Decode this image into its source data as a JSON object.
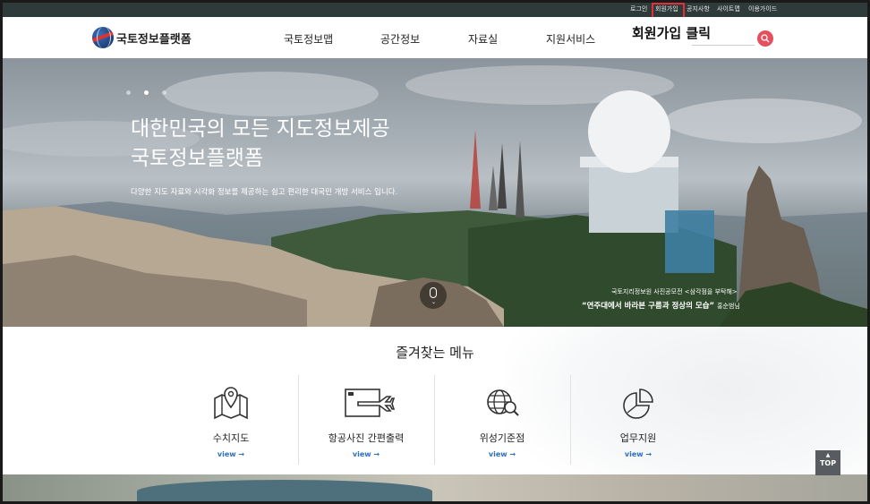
{
  "topbar": {
    "links": [
      "로그인",
      "회원가입",
      "공지사항",
      "사이트맵",
      "이용가이드"
    ]
  },
  "header": {
    "brand": "국토정보플랫폼",
    "nav": [
      "국토정보맵",
      "공간정보",
      "자료실",
      "지원서비스"
    ],
    "callout": "회원가입 클릭"
  },
  "hero": {
    "title_line1": "대한민국의 모든 지도정보제공",
    "title_line2": "국토정보플랫폼",
    "subtitle": "다양한 지도 자료와 시각화 정보를 제공하는 쉽고 편리한 대국민 개방 서비스 입니다.",
    "photo_caption": "국토지리정보원 사진공모전 <삼각점을 부탁해>",
    "photo_title": "“연주대에서 바라본 구름과 정상의 모습”",
    "photo_author": "홍순범님"
  },
  "favorites": {
    "title": "즐겨찾는 메뉴",
    "items": [
      {
        "label": "수치지도",
        "view": "view →",
        "icon": "map-pin-icon"
      },
      {
        "label": "항공사진 간편출력",
        "view": "view →",
        "icon": "airplane-icon"
      },
      {
        "label": "위성기준점",
        "view": "view →",
        "icon": "globe-search-icon"
      },
      {
        "label": "업무지원",
        "view": "view →",
        "icon": "pie-chart-icon"
      }
    ]
  },
  "top_button": "TOP",
  "colors": {
    "topbar_bg": "#2f3a3a",
    "highlight": "#e0313a",
    "search_accent": "#e5505e",
    "view_link": "#2c6fb8"
  }
}
